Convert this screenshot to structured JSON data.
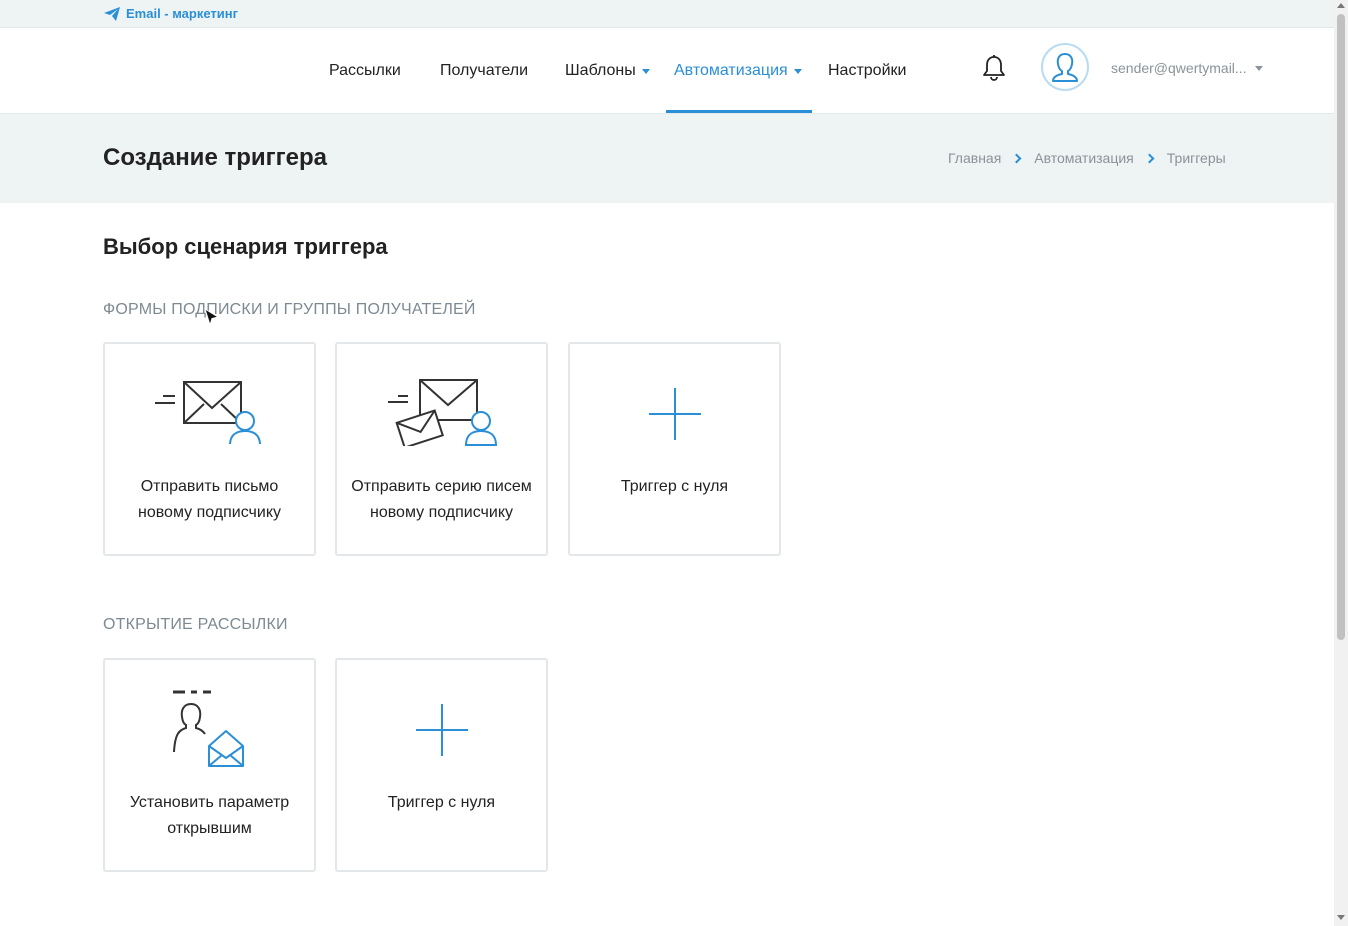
{
  "brand": {
    "label": "Email - маркетинг",
    "icon": "paper-plane-icon"
  },
  "nav": {
    "items": [
      {
        "label": "Рассылки",
        "dropdown": false,
        "active": false
      },
      {
        "label": "Получатели",
        "dropdown": false,
        "active": false
      },
      {
        "label": "Шаблоны",
        "dropdown": true,
        "active": false
      },
      {
        "label": "Автоматизация",
        "dropdown": true,
        "active": true
      },
      {
        "label": "Настройки",
        "dropdown": false,
        "active": false
      }
    ]
  },
  "user": {
    "email": "sender@qwertymail...",
    "avatar_icon": "user-avatar-icon",
    "notification_icon": "bell-icon"
  },
  "header": {
    "title": "Создание триггера",
    "breadcrumb": [
      "Главная",
      "Автоматизация",
      "Триггеры"
    ]
  },
  "main": {
    "section_title": "Выбор сценария триггера",
    "groups": [
      {
        "label": "ФОРМЫ ПОДПИСКИ И ГРУППЫ ПОЛУЧАТЕЛЕЙ",
        "cards": [
          {
            "label": "Отправить письмо новому подписчику",
            "icon": "envelope-subscriber-icon"
          },
          {
            "label": "Отправить серию писем новому подписчику",
            "icon": "envelope-series-subscriber-icon"
          },
          {
            "label": "Триггер с нуля",
            "icon": "plus-icon"
          }
        ]
      },
      {
        "label": "ОТКРЫТИЕ РАССЫЛКИ",
        "cards": [
          {
            "label": "Установить параметр открывшим",
            "icon": "user-opened-envelope-icon"
          },
          {
            "label": "Триггер с нуля",
            "icon": "plus-icon"
          }
        ]
      }
    ]
  },
  "colors": {
    "accent": "#2a8fd6",
    "band": "#eef3f4",
    "muted": "#7d8a92"
  }
}
